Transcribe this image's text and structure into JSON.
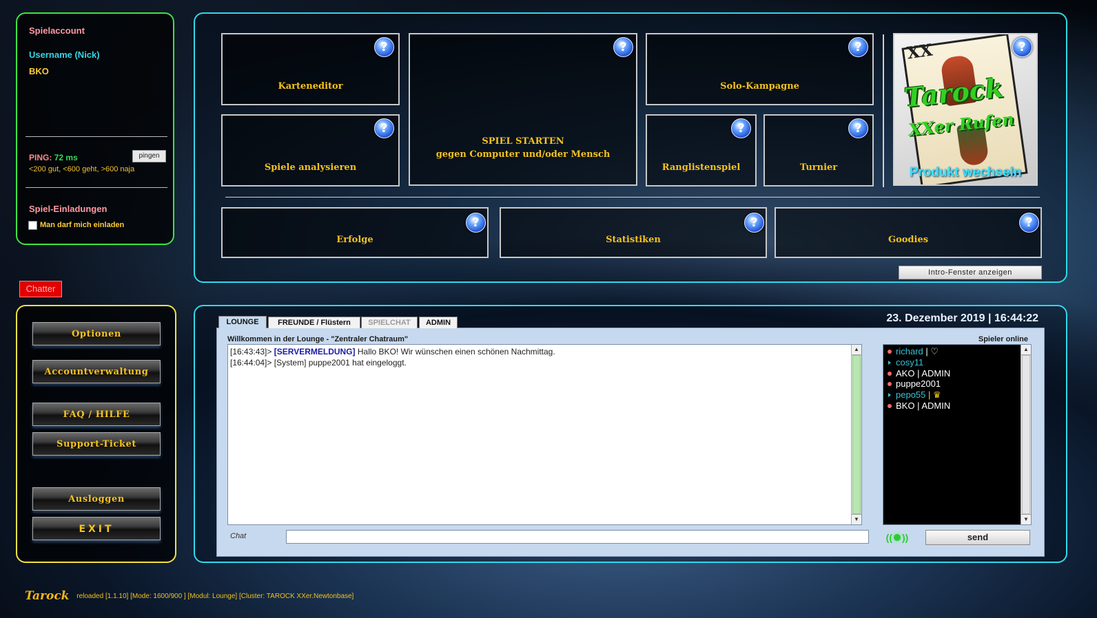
{
  "account": {
    "heading": "Spielaccount",
    "username_label": "Username (Nick)",
    "username": "BKO",
    "ping_label": "PING:",
    "ping_value": "72 ms",
    "ping_button": "pingen",
    "ping_hint": "<200 gut, <600 geht, >600 naja",
    "invites_heading": "Spiel-Einladungen",
    "invite_checkbox_label": "Man darf mich einladen",
    "invite_checked": false
  },
  "tiles": {
    "karteneditor": "Karteneditor",
    "spiel_starten_line1": "SPIEL STARTEN",
    "spiel_starten_line2": "gegen Computer und/oder Mensch",
    "solo_kampagne": "Solo-Kampagne",
    "spiele_analysieren": "Spiele analysieren",
    "ranglistenspiel": "Ranglistenspiel",
    "turnier": "Turnier",
    "erfolge": "Erfolge",
    "statistiken": "Statistiken",
    "goodies": "Goodies",
    "help_glyph": "?"
  },
  "product": {
    "card_number": "XX",
    "logo_line1": "Tarock",
    "logo_line2": "XXer Rufen",
    "switch_label": "Produkt wechseln"
  },
  "intro_button": "Intro-Fenster anzeigen",
  "chatter_label": "Chatter",
  "menu": {
    "optionen": "Optionen",
    "accountverwaltung": "Accountverwaltung",
    "faq": "FAQ / HILFE",
    "support": "Support-Ticket",
    "ausloggen": "Ausloggen",
    "exit": "EXIT"
  },
  "chat": {
    "datetime": "23. Dezember 2019 | 16:44:22",
    "tabs": [
      "LOUNGE",
      "FREUNDE  / Flüstern",
      "SPIELCHAT",
      "ADMIN"
    ],
    "welcome": "Willkommen in der Lounge - \"Zentraler Chatraum\"",
    "online_heading": "Spieler online",
    "messages": [
      {
        "time": "[16:43:43]>",
        "tag": "[SERVERMELDUNG]",
        "text": "Hallo BKO! Wir wünschen einen schönen Nachmittag."
      },
      {
        "time": "[16:44:04]>",
        "tag": "",
        "text": "[System] puppe2001 hat eingeloggt."
      }
    ],
    "players": [
      {
        "name": "richard",
        "suffix": " | ♡"
      },
      {
        "name": "cosy11",
        "suffix": ""
      },
      {
        "name": "AKO",
        "suffix": " | ADMIN"
      },
      {
        "name": "puppe2001",
        "suffix": ""
      },
      {
        "name": "pepo55",
        "suffix": " | ♛"
      },
      {
        "name": "BKO",
        "suffix": " | ADMIN"
      }
    ],
    "chat_label": "Chat",
    "input_value": "",
    "send_label": "send",
    "signal_glyph_left": "((",
    "signal_glyph_right": "))"
  },
  "footer": {
    "brand": "Tarock",
    "info": "reloaded [1.1.10] [Mode: 1600/900 ] [Modul: Lounge] [Cluster: TAROCK XXer.Newtonbase]"
  }
}
